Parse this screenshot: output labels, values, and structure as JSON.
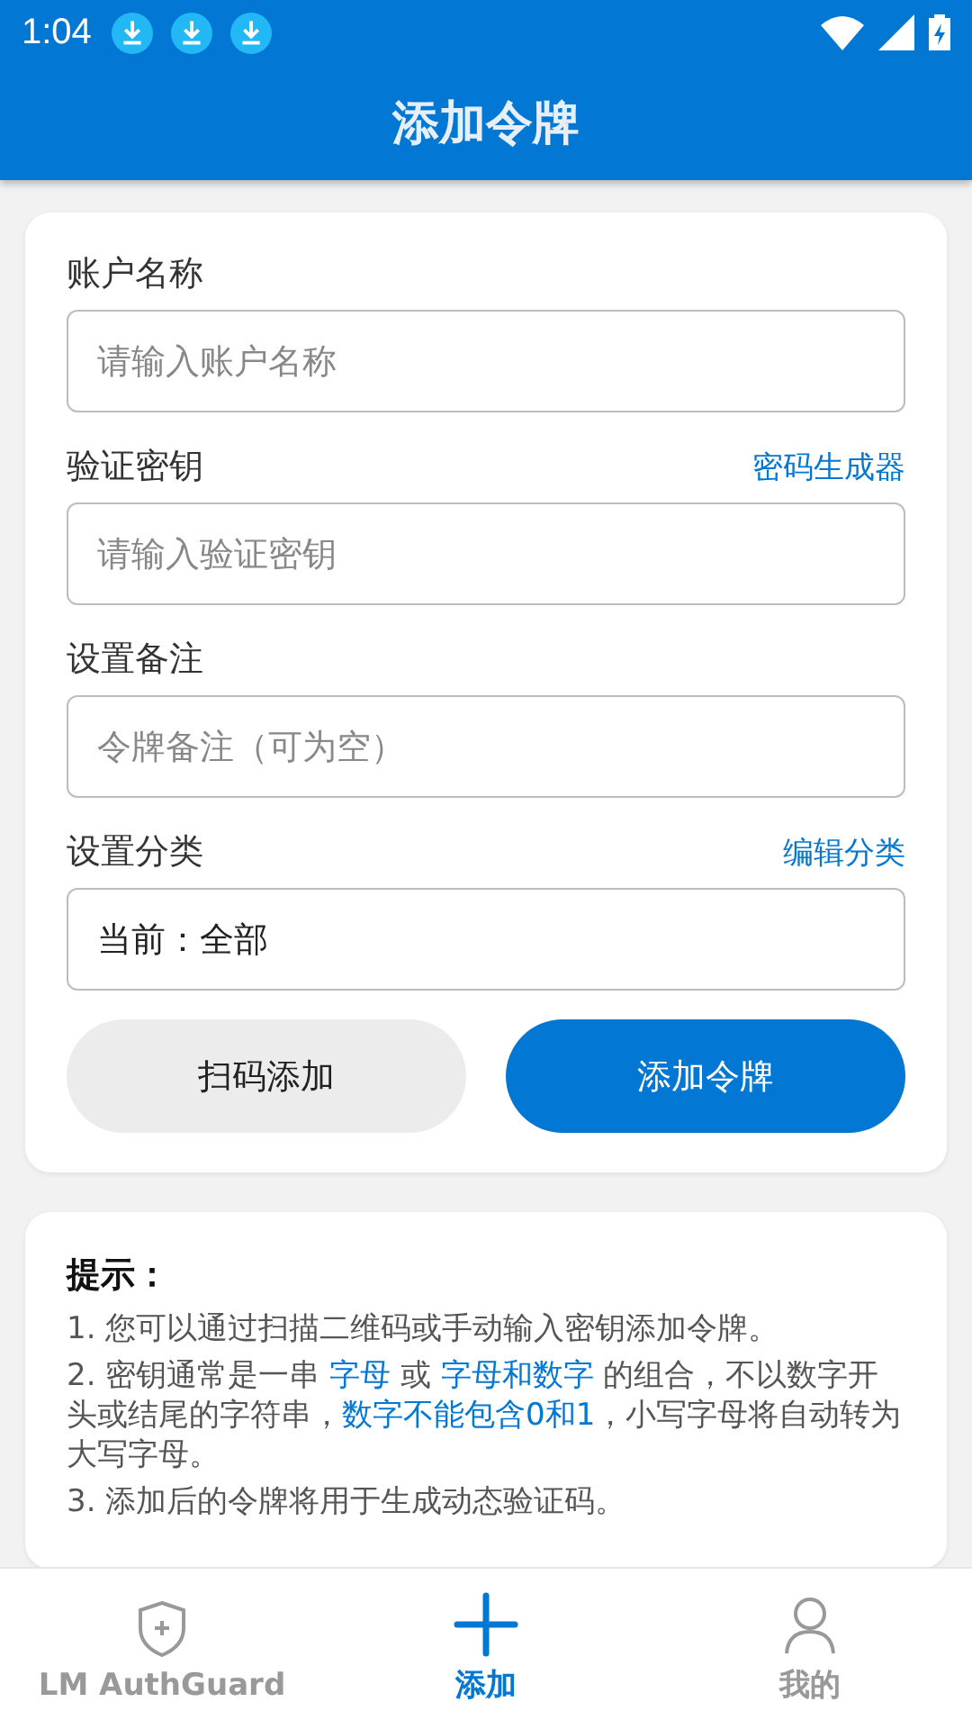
{
  "status_bar": {
    "time": "1:04",
    "notifications": [
      {
        "kind": "download"
      },
      {
        "kind": "download"
      },
      {
        "kind": "download"
      }
    ]
  },
  "app_bar": {
    "title": "添加令牌"
  },
  "form": {
    "fields": [
      {
        "label": "账户名称",
        "placeholder": "请输入账户名称"
      },
      {
        "label": "验证密钥",
        "link": "密码生成器",
        "placeholder": "请输入验证密钥"
      },
      {
        "label": "设置备注",
        "placeholder": "令牌备注（可为空）"
      },
      {
        "label": "设置分类",
        "link": "编辑分类",
        "value": "当前：全部"
      }
    ],
    "buttons": [
      {
        "label": "扫码添加",
        "kind": "secondary"
      },
      {
        "label": "添加令牌",
        "kind": "primary"
      }
    ]
  },
  "tips": {
    "title": "提示：",
    "items": [
      [
        {
          "text": "1. 您可以通过扫描二维码或手动输入密钥添加令牌。",
          "highlight": false
        }
      ],
      [
        {
          "text": "2. 密钥通常是一串 ",
          "highlight": false
        },
        {
          "text": "字母",
          "highlight": true
        },
        {
          "text": " 或 ",
          "highlight": false
        },
        {
          "text": "字母和数字",
          "highlight": true
        },
        {
          "text": " 的组合，不以数字开头或结尾的字符串，",
          "highlight": false
        },
        {
          "text": "数字不能包含0和1",
          "highlight": true
        },
        {
          "text": "，小写字母将自动转为大写字母。",
          "highlight": false
        }
      ],
      [
        {
          "text": "3. 添加后的令牌将用于生成动态验证码。",
          "highlight": false
        }
      ]
    ]
  },
  "bottom_nav": [
    {
      "label": "LM AuthGuard",
      "selected": false
    },
    {
      "label": "添加",
      "selected": true
    },
    {
      "label": "我的",
      "selected": false
    }
  ]
}
